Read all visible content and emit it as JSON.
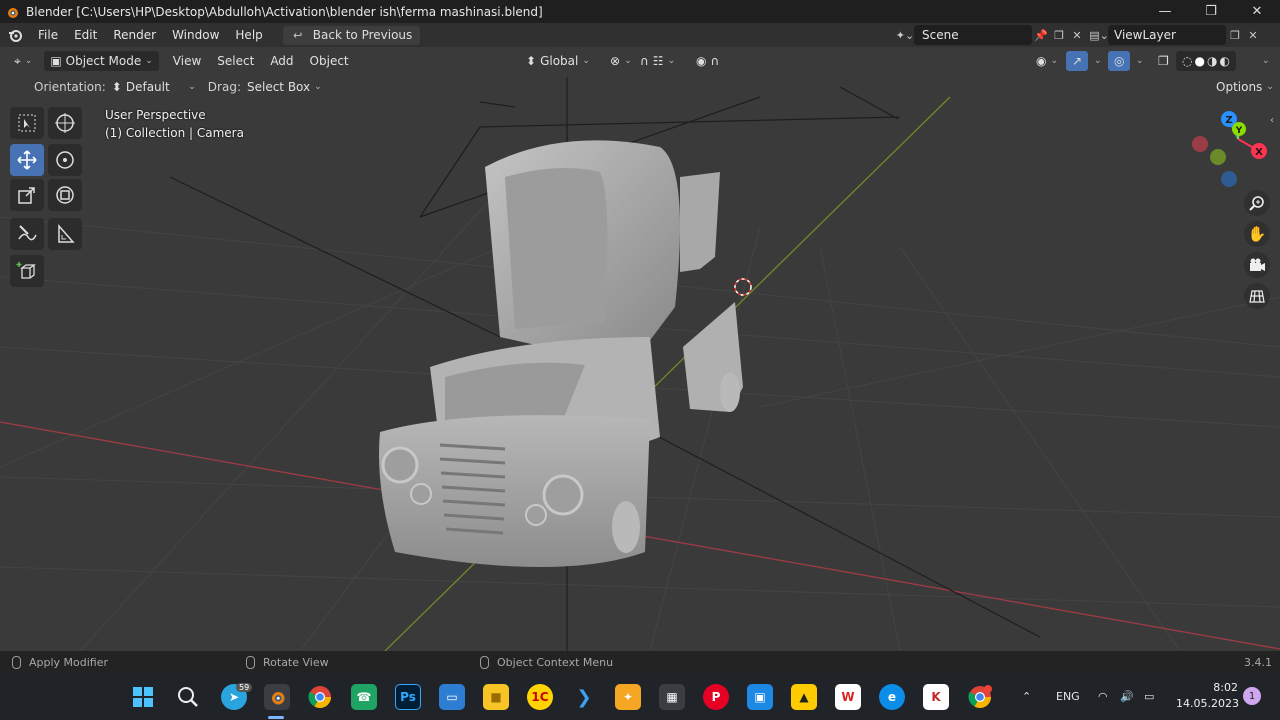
{
  "window": {
    "title": "Blender [C:\\Users\\HP\\Desktop\\Abdulloh\\Activation\\blender ish\\ferma mashinasi.blend]",
    "controls": [
      "minimize",
      "restore",
      "close"
    ]
  },
  "menubar": {
    "items": [
      "File",
      "Edit",
      "Render",
      "Window",
      "Help"
    ],
    "back_button": "Back to Previous",
    "scene": "Scene",
    "view_layer": "ViewLayer"
  },
  "viewport_header": {
    "mode": "Object Mode",
    "menus": [
      "View",
      "Select",
      "Add",
      "Object"
    ],
    "transform_orientation": "Global"
  },
  "tool_settings": {
    "orientation_label": "Orientation:",
    "orientation_value": "Default",
    "drag_label": "Drag:",
    "drag_value": "Select Box",
    "options": "Options"
  },
  "overlay": {
    "view_name": "User Perspective",
    "collection_info": "(1) Collection | Camera"
  },
  "gizmo": {
    "z": "Z",
    "y": "Y",
    "x": "X"
  },
  "statusbar": {
    "left": "Apply Modifier",
    "middle": "Rotate View",
    "right": "Object Context Menu",
    "version": "3.4.1"
  },
  "taskbar": {
    "telegram_badge": "59",
    "language": "ENG",
    "time": "8:02",
    "date": "14.05.2023",
    "notification_count": "1"
  },
  "colors": {
    "viewport_bg": "#3a3a3a",
    "active_tool": "#4772b3",
    "axis_x": "#ff3352",
    "axis_y": "#8bdc00",
    "axis_z": "#2890ff"
  }
}
